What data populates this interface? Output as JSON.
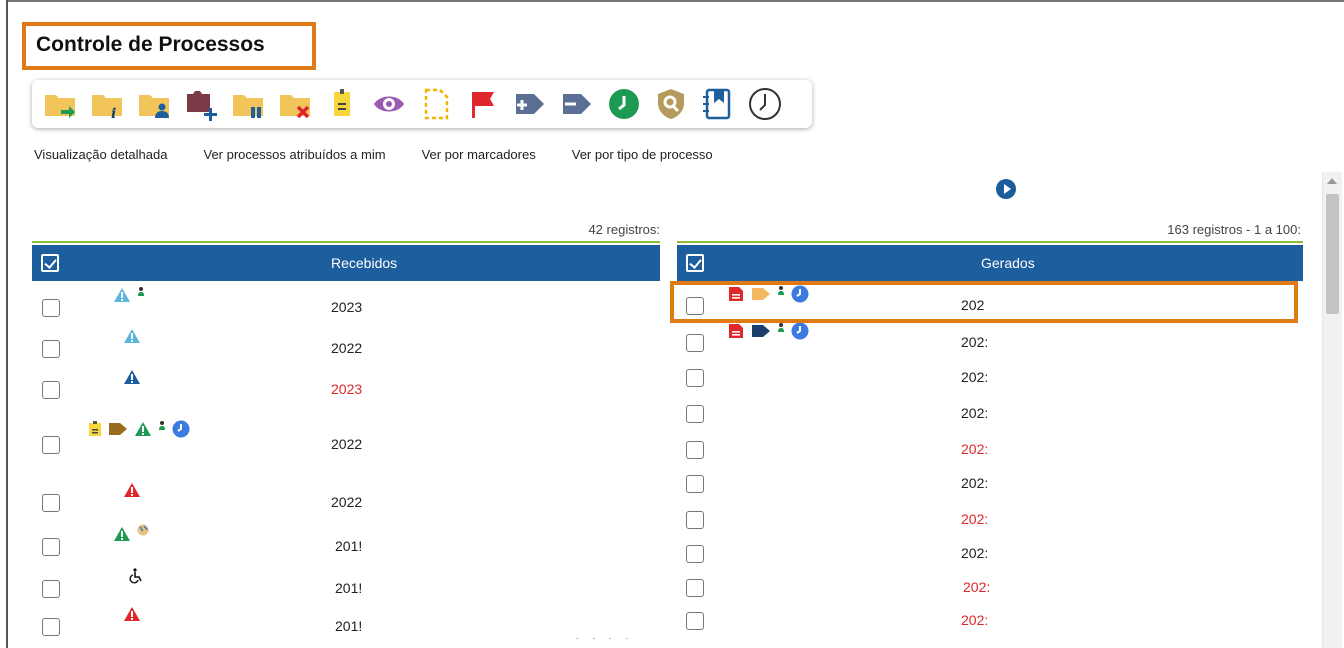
{
  "page": {
    "title": "Controle de Processos"
  },
  "toolbar": {
    "buttons": [
      {
        "icon": "folder-send-icon"
      },
      {
        "icon": "folder-info-icon"
      },
      {
        "icon": "folder-user-icon"
      },
      {
        "icon": "folder-add-icon"
      },
      {
        "icon": "folder-pause-icon"
      },
      {
        "icon": "folder-remove-icon"
      },
      {
        "icon": "note-icon"
      },
      {
        "icon": "eye-icon"
      },
      {
        "icon": "dashed-document-icon"
      },
      {
        "icon": "flag-icon"
      },
      {
        "icon": "tag-add-icon"
      },
      {
        "icon": "tag-remove-icon"
      },
      {
        "icon": "clock-icon"
      },
      {
        "icon": "shield-search-icon"
      },
      {
        "icon": "bookmark-list-icon"
      },
      {
        "icon": "clock-outline-icon"
      }
    ]
  },
  "view_links": {
    "detailed": "Visualização detalhada",
    "assigned": "Ver processos atribuídos a mim",
    "markers": "Ver por marcadores",
    "type": "Ver por tipo de processo"
  },
  "received": {
    "count": "42 registros:",
    "header": "Recebidos",
    "rows": [
      {
        "text": "2023",
        "red": false,
        "icons": [
          "alert-lightblue-icon",
          "person-small-icon"
        ]
      },
      {
        "text": "2022",
        "red": false,
        "icons": [
          "alert-lightblue-icon"
        ]
      },
      {
        "text": "2023",
        "red": true,
        "icons": [
          "alert-blue-icon"
        ]
      },
      {
        "text": "2022",
        "red": false,
        "icons": [
          "note-icon",
          "tag-brown-icon",
          "alert-green-icon",
          "person-small-icon",
          "clock-blue-icon"
        ]
      },
      {
        "text": "2022",
        "red": false,
        "icons": [
          "alert-red-icon"
        ]
      },
      {
        "text": "201!",
        "red": false,
        "icons": [
          "alert-green-icon",
          "globe-icon"
        ]
      },
      {
        "text": "201!",
        "red": false,
        "icons": [
          "wheelchair-icon"
        ]
      },
      {
        "text": "201!",
        "red": false,
        "icons": [
          "alert-red-icon"
        ]
      }
    ]
  },
  "generated": {
    "count": "163 registros - 1 a 100:",
    "header": "Gerados",
    "rows": [
      {
        "text": "202",
        "red": false,
        "icons": [
          "document-red-icon",
          "tag-orange-icon",
          "person-small-icon",
          "clock-blue-icon"
        ]
      },
      {
        "text": "202:",
        "red": false,
        "icons": [
          "document-red-icon",
          "tag-navy-icon",
          "person-small-icon",
          "clock-blue-icon"
        ]
      },
      {
        "text": "202:",
        "red": false,
        "icons": []
      },
      {
        "text": "202:",
        "red": false,
        "icons": []
      },
      {
        "text": "202:",
        "red": true,
        "icons": []
      },
      {
        "text": "202:",
        "red": false,
        "icons": []
      },
      {
        "text": "202:",
        "red": true,
        "icons": []
      },
      {
        "text": "202:",
        "red": false,
        "icons": []
      },
      {
        "text": "202:",
        "red": true,
        "icons": []
      },
      {
        "text": "202:",
        "red": true,
        "icons": []
      }
    ]
  },
  "colors": {
    "header_bg": "#1c5e9e",
    "highlight": "#e07a16",
    "red_text": "#e0272b"
  }
}
